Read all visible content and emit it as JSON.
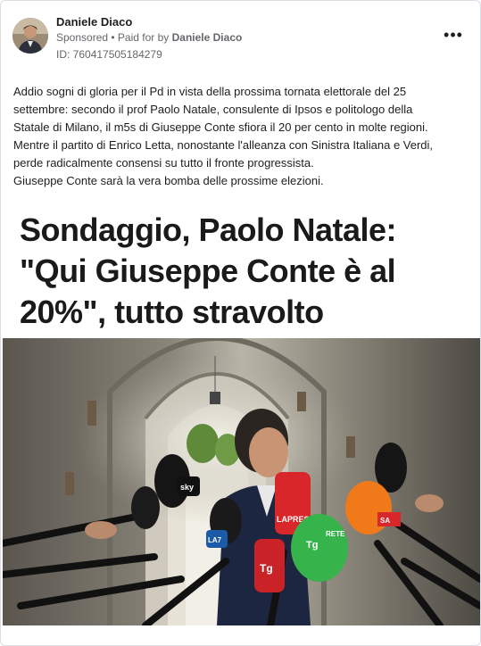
{
  "post": {
    "author": "Daniele Diaco",
    "sponsored": "Sponsored",
    "paid_for_prefix": " • Paid for by ",
    "paid_for_name": "Daniele Diaco",
    "ad_id": "ID: 760417505184279",
    "more_icon": "more-horizontal-icon",
    "text_lines": [
      "Addio sogni di gloria per il Pd in vista della prossima tornata elettorale del 25",
      "settembre: secondo il prof Paolo Natale, consulente di Ipsos e politologo della",
      "Statale di Milano, il m5s di Giuseppe Conte sfiora il 20 per cento in molte regioni.",
      "Mentre il partito di Enrico Letta, nonostante l'alleanza con Sinistra Italiana e Verdi,",
      "perde radicalmente consensi su tutto il fronte progressista.",
      "Giuseppe Conte sarà la vera bomba delle prossime elezioni."
    ]
  },
  "creative": {
    "headline_lines": [
      "Sondaggio, Paolo Natale:",
      "\"Qui Giuseppe Conte è al",
      "20%\", tutto stravolto"
    ],
    "mic_labels": {
      "la_presse": "LAPRESSE",
      "tg": "Tg",
      "sky": "sky",
      "tg_green": "Tg",
      "rete": "RETE",
      "sa": "SA",
      "la7": "LA7"
    }
  },
  "colors": {
    "text": "#1c1e21",
    "secondary": "#65676b",
    "border": "#dadde1",
    "mic_red": "#d8262b",
    "mic_green": "#36b34a",
    "mic_orange": "#f07a1a"
  }
}
